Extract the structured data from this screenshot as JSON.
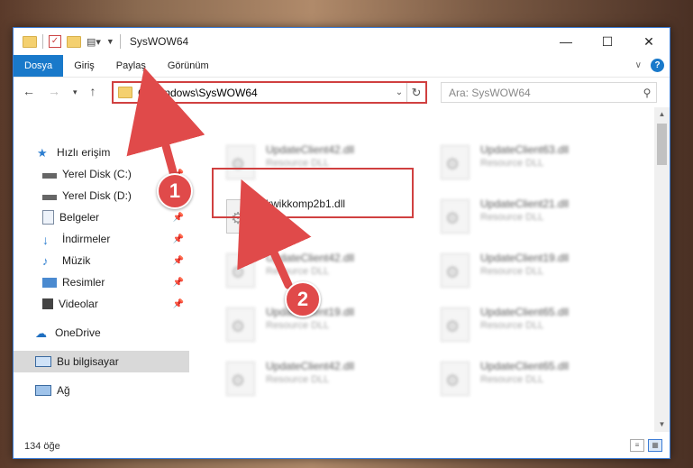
{
  "window": {
    "title": "SysWOW64"
  },
  "controls": {
    "minimize": "—",
    "maximize": "☐",
    "close": "✕"
  },
  "ribbon": {
    "tabs": [
      "Dosya",
      "Giriş",
      "Paylaş",
      "Görünüm"
    ]
  },
  "address": {
    "path": "C:\\Windows\\SysWOW64",
    "search_placeholder": "Ara: SysWOW64"
  },
  "sidebar": {
    "items": [
      {
        "label": "Hızlı erişim",
        "icon": "star-icon"
      },
      {
        "label": "Yerel Disk (C:)",
        "icon": "drive-icon"
      },
      {
        "label": "Yerel Disk (D:)",
        "icon": "drive-icon"
      },
      {
        "label": "Belgeler",
        "icon": "documents-icon"
      },
      {
        "label": "İndirmeler",
        "icon": "download-icon"
      },
      {
        "label": "Müzik",
        "icon": "music-icon"
      },
      {
        "label": "Resimler",
        "icon": "pictures-icon"
      },
      {
        "label": "Videolar",
        "icon": "video-icon"
      },
      {
        "label": "OneDrive",
        "icon": "cloud-icon"
      },
      {
        "label": "Bu bilgisayar",
        "icon": "computer-icon"
      },
      {
        "label": "Ağ",
        "icon": "network-icon"
      }
    ]
  },
  "files": [
    {
      "name": "UpdateClient42.dll",
      "desc": "Resource DLL"
    },
    {
      "name": "UpdateClient63.dll",
      "desc": "Resource DLL"
    },
    {
      "name": "kwikkomp2b1.dll",
      "desc": ""
    },
    {
      "name": "UpdateClient21.dll",
      "desc": "Resource DLL"
    },
    {
      "name": "UpdateClient42.dll",
      "desc": "Resource DLL"
    },
    {
      "name": "UpdateClient19.dll",
      "desc": "Resource DLL"
    },
    {
      "name": "UpdateClient19.dll",
      "desc": "Resource DLL"
    },
    {
      "name": "UpdateClient65.dll",
      "desc": "Resource DLL"
    },
    {
      "name": "UpdateClient42.dll",
      "desc": "Resource DLL"
    },
    {
      "name": "UpdateClient65.dll",
      "desc": "Resource DLL"
    }
  ],
  "status": {
    "count": "134 öğe"
  },
  "annotations": {
    "badge1": "1",
    "badge2": "2",
    "color": "#e04a4a"
  }
}
